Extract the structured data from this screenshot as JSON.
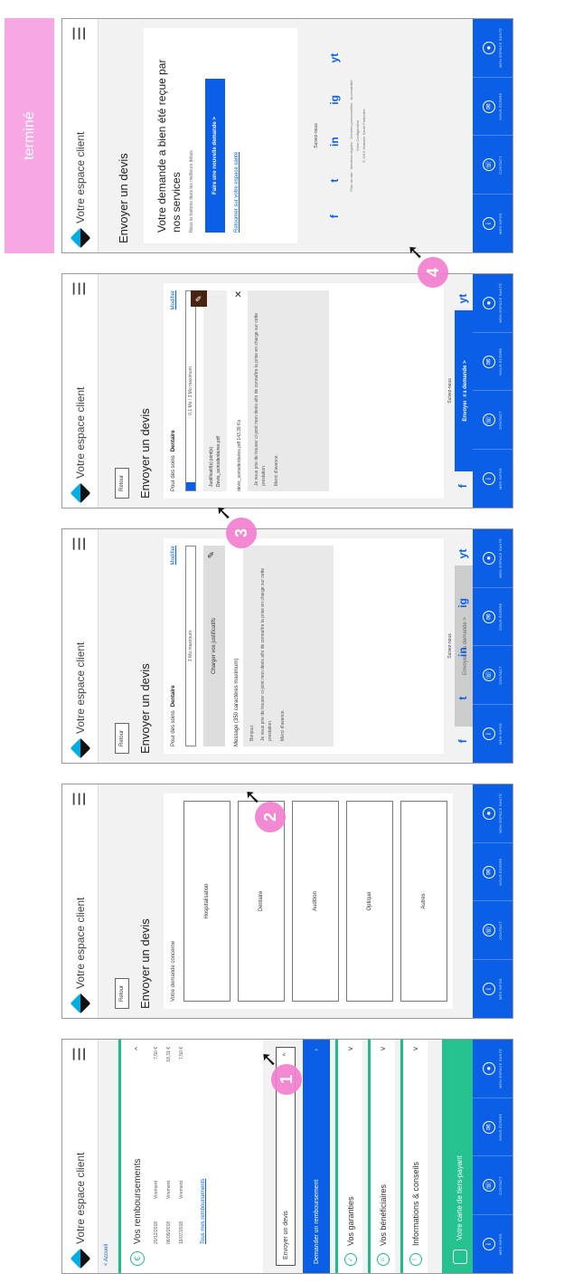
{
  "app_title": "Votre espace client",
  "done_tag": "terminé",
  "nav": [
    "Mes infos",
    "Contact",
    "Nous écrire",
    "Mon espace santé"
  ],
  "screen1": {
    "back": "< Accueil",
    "remb_title": "Vos remboursements",
    "rows": [
      {
        "date": "20/12/2018",
        "type": "Virement",
        "amount": "7,50 €"
      },
      {
        "date": "06/09/2018",
        "type": "Virement",
        "amount": "18,31 €"
      },
      {
        "date": "16/07/2018",
        "type": "Virement",
        "amount": "7,50 €"
      }
    ],
    "more": "Tous mes remboursements",
    "devis_field": "Envoyer un devis",
    "demander": "Demander un remboursement",
    "acc": [
      "Vos garanties",
      "Vos bénéficiaires",
      "Informations & conseils"
    ],
    "tiers": "Votre carte de tiers-payant"
  },
  "screen2": {
    "retour": "Retour",
    "title": "Envoyer un devis",
    "label": "Votre demande concerne",
    "options": [
      "Hospitalisation",
      "Dentaire",
      "Audition",
      "Optique",
      "Autres"
    ]
  },
  "screen3": {
    "care_label": "Pour des soins",
    "care_value": "Dentaire",
    "modify": "Modifier",
    "progress": "3 Mo maximum",
    "upload": "Charger vos justificatifs",
    "msg_label": "Message (350 caractères maximum)",
    "msg": [
      "Bonjour,",
      "Je vous prie de trouver ci-joint mon devis afin de connaître la prise en charge sur cette prestation.",
      "Merci d'avance."
    ],
    "send": "Envoyer ma demande >"
  },
  "screen4": {
    "progress": "0,1 Mo / 3 Mo maximum",
    "progress_value": 0.04,
    "just": [
      "Justificatif(s) joint(s)",
      "Devis_soinsdentaires.pdf"
    ],
    "file": "devis_soinsdentaires.pdf 143.39 Ko",
    "send": "Envoyer ma demande >",
    "follow": "Suivez-nous"
  },
  "screen5": {
    "done_title": "Votre demande a bien été reçue par nos services",
    "done_sub": "Nous la traitons dans les meilleurs délais.",
    "new_req": "Faire une nouvelle demande >",
    "back_link": "Retourner sur votre espace santé",
    "follow": "Suivez-nous",
    "footer": [
      "Plan du site · Mentions légales · Données personnelles · Accessibilité",
      "Votre Configuration",
      "© 2019 Mutuelle Santé Particulier"
    ]
  },
  "socials": [
    "f",
    "t",
    "in",
    "ig",
    "yt"
  ],
  "steps": [
    "1",
    "2",
    "3",
    "4"
  ]
}
